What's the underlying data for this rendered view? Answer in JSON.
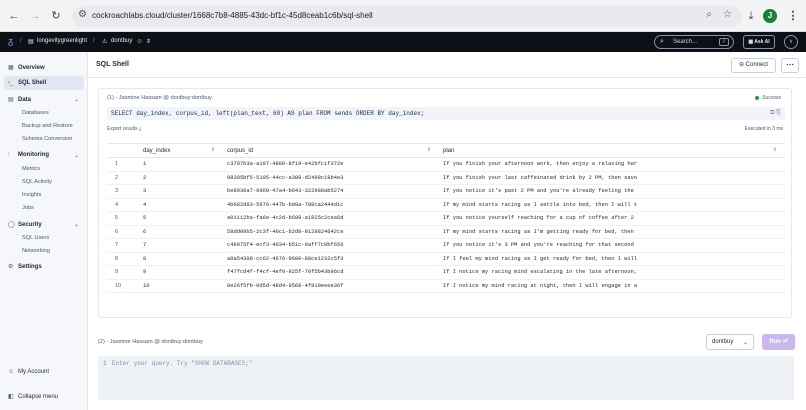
{
  "browser": {
    "url": "cockroachlabs.cloud/cluster/1668c7b8-4885-43dc-bf1c-45d8ceab1c6b/sql-shell",
    "profile_initial": "J"
  },
  "app": {
    "org": "longevitygreenlight",
    "cluster": "dontbuy",
    "search_label": "Search...",
    "search_kbd": "/",
    "ask_ai": "Ask AI"
  },
  "sidebar": {
    "overview": "Overview",
    "sql_shell": "SQL Shell",
    "data": "Data",
    "data_items": [
      "Databases",
      "Backup and Restore",
      "Schema Conversion"
    ],
    "monitoring": "Monitoring",
    "monitoring_items": [
      "Metrics",
      "SQL Activity",
      "Insights",
      "Jobs"
    ],
    "security": "Security",
    "security_items": [
      "SQL Users",
      "Networking"
    ],
    "settings": "Settings",
    "my_account": "My Account",
    "collapse": "Collapse menu"
  },
  "main": {
    "title": "SQL Shell",
    "connect": "Connect",
    "more": "⋯"
  },
  "query1": {
    "header": "(1) - Jasmine Hassam @ dontbuy:dontbuy",
    "status": "Success",
    "sql": "SELECT day_index, corpus_id, left(plan_text, 60) AS plan FROM sends ORDER BY day_index;",
    "export": "Export results",
    "executed": "Executed in 3 ms",
    "columns": [
      "day_index",
      "corpus_id",
      "plan"
    ],
    "rows": [
      [
        "1",
        "1",
        "c3797b3a-a197-4880-8f19-e42bfc1f372e",
        "If you finish your afternoon work, then enjoy a relaxing her"
      ],
      [
        "2",
        "2",
        "88395bf5-5195-44cc-a308-d2499c18b4e3",
        "If you finish your last caffeinated drink by 2 PM, then savo"
      ],
      [
        "3",
        "3",
        "be8930a7-9d69-47a4-b643-322988ab5274",
        "If you notice it's past 2 PM and you're already feeling the"
      ],
      [
        "4",
        "4",
        "4b682d83-5976-447b-b09a-788ca2444d1c",
        "If my mind starts racing as I settle into bed, then I will t"
      ],
      [
        "5",
        "5",
        "a01112ba-fa6e-4c2d-b608-a1825c2cea6d",
        "If you notice yourself reaching for a cup of coffee after 2"
      ],
      [
        "6",
        "6",
        "58dd09b5-2c3f-40c1-b2d8-9128824642ce",
        "If my mind starts racing as I'm getting ready for bed, then"
      ],
      [
        "7",
        "7",
        "c4b075f4-ecf3-4034-b51c-9aff7c0bf656",
        "If you notice it's 3 PM and you're reaching for that second"
      ],
      [
        "8",
        "8",
        "a0a54308-cc62-4676-9600-88ce1232c5f3",
        "If I feel my mind racing as I get ready for bed, then I will"
      ],
      [
        "9",
        "9",
        "f47fcd4f-f4cf-4ef0-925f-70f5b43b96cd",
        "If I notice my racing mind escalating in the late afternoon,"
      ],
      [
        "10",
        "10",
        "8e26f5fb-0d5d-48d4-9568-4f810eeee36f",
        "If I notice my mind racing at night, then I will engage in a"
      ]
    ]
  },
  "query2": {
    "header": "(2) - Jasmine Hassam @ dontbuy:dontbuy",
    "database": "dontbuy",
    "run": "Run ⏎",
    "line_no": "1",
    "placeholder": "Enter your query. Try \"SHOW DATABASES;\""
  }
}
